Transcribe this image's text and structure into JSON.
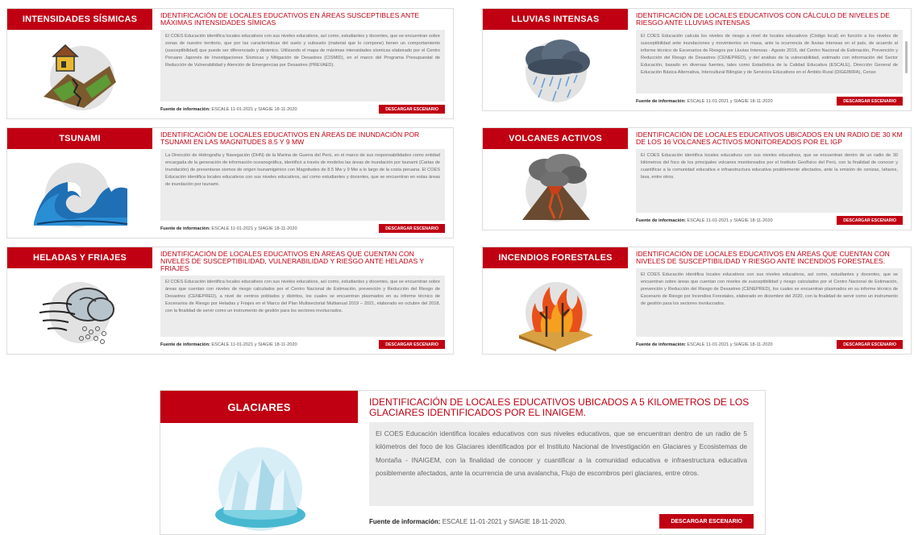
{
  "source_label": "Fuente de información:",
  "source_text": "ESCALE 11-01-2021 y SIAGIE 18-11-2020",
  "source_text_big": "ESCALE 11-01-2021 y SIAGIE 18-11-2020.",
  "download_label": "DESCARGAR ESCENARIO",
  "cards": [
    {
      "header": "INTENSIDADES SÍSMICAS",
      "title": "IDENTIFICACIÓN DE LOCALES EDUCATIVOS EN ÁREAS SUSCEPTIBLES ANTE MÁXIMAS INTENSIDADES SÍMICAS",
      "body": "El COES Educación identifica locales educativos con sus niveles educativos, así como, estudiantes y docentes, que se encuentran sobre zonas de nuestro territorio, que por las características del suelo y subsuelo (material que lo compone) tienen un comportamiento (susceptibilidad) que puede ser diferenciado y dinámico. Utilizando el mapa de máximas intensidades sísmicas elaborado por el Centro Peruano Japonés de Investigaciones Sísmicas y Mitigación de Desastres (CISMID), en el marco del Programa Presupuestal de Reducción de Vulnerabilidad y Atención de Emergencias por Desastres (PREVAED)."
    },
    {
      "header": "LLUVIAS INTENSAS",
      "title": "IDENTIFICACIÓN DE LOCALES EDUCATIVOS CON CÁLCULO DE NIVELES DE RIESGO ANTE LLUVIAS INTENSAS",
      "body": "El COES Educación calcula los niveles de riesgo a nivel de locales educativos (Código local) en función a los niveles de susceptibilidad ante inundaciones y movimientos en masa, ante la ocurrencia de lluvias intensas en el país, de acuerdo al informe técnico de Escenarios de Riesgos por Lluvias Intensas - Agosto 2016, del Centro Nacional de Estimación, Prevención y Reducción del Riesgo de Desastres (CENEPRED), y del análisis de la vulnerabilidad, estimado con información del Sector Educación, basado en diversas fuentes, tales como Estadística de la Calidad Educativa (ESCALE), Dirección General de Educación Básica Alternativa, Intercultural Bilingüe y de Servicios Educativos en el Ámbito Rural (DIGEIBIRA), Censo"
    },
    {
      "header": "TSUNAMI",
      "title": "IDENTIFICACIÓN DE LOCALES EDUCATIVOS EN ÁREAS DE INUNDACIÓN POR TSUNAMI EN LAS MAGNITUDES 8.5 Y 9 MW",
      "body": "La Dirección de Hidrografía y Navegación (DHN) de la Marina de Guerra del Perú, en el marco de sus responsabilidades como entidad encargada de la generación de información oceanográfica, identificó a través de modelos las áreas de inundación por tsunami (Cartas de Inundación) de presentarse sismos de origen tsunamigénico con Magnitudes de 8.5 Mw y 9 Mw a lo largo de la costa peruana. El COES Educación identifica locales educativos con sus niveles educativos, así como estudiantes y docentes, que se encuentran en estas áreas de inundación por tsunami."
    },
    {
      "header": "VOLCANES ACTIVOS",
      "title": "IDENTIFICACIÓN DE LOCALES EDUCATIVOS UBICADOS EN UN RADIO DE 30 KM DE LOS 16 VOLCANES ACTIVOS MONITOREADOS POR EL IGP",
      "body": "El COES Educación identifica locales educativos con sus niveles educativos, que se encuentran dentro de un radio de 30 kilómetros del foco de los principales volcanes monitoreados por el Instituto Geofísico del Perú, con la finalidad de conocer y cuantificar a la comunidad educativa e infraestructura educativa posiblemente afectados, ante la emisión de cenizas, lahares, lava, entre otros."
    },
    {
      "header": "HELADAS Y FRIAJES",
      "title": "IDENTIFICACIÓN DE LOCALES EDUCATIVOS EN ÁREAS QUE CUENTAN CON NIVELES DE SUSCEPTIBILIDAD, VULNERABILIDAD Y RIESGO ANTE HELADAS Y FRIAJES",
      "body": "El COES Educación identifica locales educativos con sus niveles educativos, así como, estudiantes y docentes, que se encuentran sobre áreas que cuentan con niveles de riesgo calculados por el Centro Nacional de Estimación, prevención y Reducción del Riesgo de Desastres (CENEPRED), a nivel de centros poblados y distritos, los cuales se encuentran plasmados en su informe técnico de Escenarios de Riesgo por Heladas y Friajes en el Marco del Plan Multisectorial Multianual 2019 – 2021, elaborado en octubre del 2018, con la finalidad de servir como un instrumento de gestión para los sectores involucrados."
    },
    {
      "header": "INCENDIOS FORESTALES",
      "title": "IDENTIFICACIÓN DE LOCALES EDUCATIVOS EN ÁREAS QUE CUENTAN CON NIVELES DE SUSCEPTIBILIDAD Y RIESGO ANTE INCENDIOS FORESTALES.",
      "body": "El COES Educación identifica locales educativos con sus niveles educativos, así como, estudiantes y docentes, que se encuentran sobre áreas que cuentan con niveles de susceptibilidad y riesgo calculados por el Centro Nacional de Estimación, prevención y Reducción del Riesgo de Desastres (CENEPRED), los cuales se encuentran plasmados en su informe técnico de Escenario de Riesgo por Incendios Forestales, elaborado en diciembre del 2020, con la finalidad de servir como un instrumento de gestión para los sectores involucrados."
    },
    {
      "header": "GLACIARES",
      "title": "IDENTIFICACIÓN DE LOCALES EDUCATIVOS UBICADOS A 5 KILOMETROS DE LOS GLACIARES IDENTIFICADOS POR EL INAIGEM.",
      "body": "El COES Educación identifica locales educativos con sus niveles educativos, que se encuentran dentro de un radio de 5 kilómetros del foco de los Glaciares identificados por el Instituto Nacional de Investigación en Glaciares y Ecosistemas de Montaña - INAIGEM, con la finalidad de conocer y cuantificar a la comunidad educativa e infraestructura educativa posiblemente afectados, ante la ocurrencia de una avalancha, Flujo de escombros peri glaciares, entre otros."
    }
  ],
  "icons": [
    "earthquake-icon",
    "rain-cloud-icon",
    "tsunami-wave-icon",
    "volcano-icon",
    "frost-wind-icon",
    "forest-fire-icon",
    "glacier-icon"
  ],
  "colors": {
    "accent": "#c00012",
    "panel": "#ececec",
    "body_text": "#666666"
  }
}
